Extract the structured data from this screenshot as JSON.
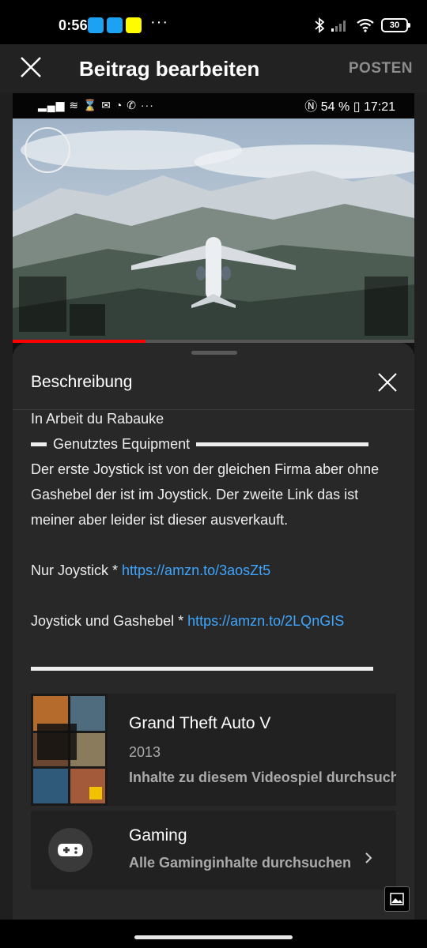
{
  "status_bar": {
    "time": "0:56",
    "more": "···",
    "battery": "30"
  },
  "header": {
    "title": "Beitrag bearbeiten",
    "post_label": "POSTEN"
  },
  "media": {
    "inner_status_right": "54 %",
    "inner_time": "17:21",
    "progress": 0.33
  },
  "sheet": {
    "title": "Beschreibung",
    "lines": {
      "l1": "In Arbeit du Rabauke",
      "equipment": "Genutztes Equipment",
      "para": "Der erste Joystick ist von der gleichen Firma aber ohne Gashebel der ist im Joystick. Der zweite Link das ist meiner aber leider ist dieser ausverkauft.",
      "j1_label": "Nur Joystick * ",
      "j1_link": "https://amzn.to/3aosZt5",
      "j2_label": "Joystick und Gashebel * ",
      "j2_link": "https://amzn.to/2LQnGIS"
    }
  },
  "game_card": {
    "title": "Grand Theft Auto V",
    "year": "2013",
    "action": "Inhalte zu diesem Videospiel durchsuchen"
  },
  "gaming_card": {
    "title": "Gaming",
    "action": "Alle Gaminginhalte durchsuchen"
  },
  "colors": {
    "link": "#3ea6ff",
    "progress": "#ff0000",
    "twitter": "#1da1f2",
    "snapchat": "#fffc00"
  }
}
